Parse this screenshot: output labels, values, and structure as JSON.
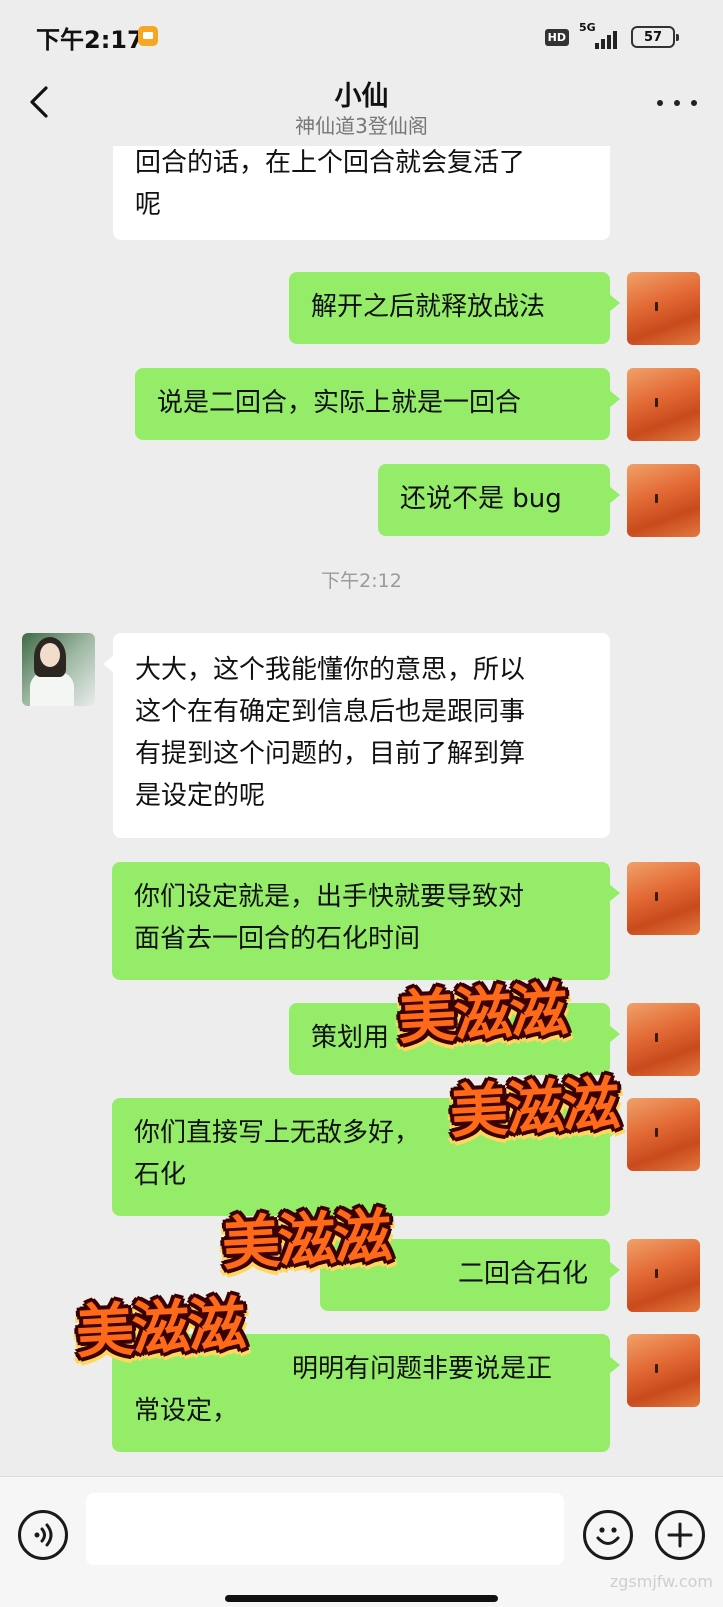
{
  "status_bar": {
    "time": "下午2:17",
    "network": "5G",
    "hd": "HD",
    "battery": "57"
  },
  "header": {
    "title": "小仙",
    "subtitle": "神仙道3登仙阁"
  },
  "messages": [
    {
      "side": "in",
      "lines": [
        "回合的话，在上个回合就会复活了",
        "呢"
      ]
    },
    {
      "side": "out",
      "lines": [
        "解开之后就释放战法"
      ]
    },
    {
      "side": "out",
      "lines": [
        "说是二回合，实际上就是一回合"
      ]
    },
    {
      "side": "out",
      "lines": [
        "还说不是 bug"
      ]
    },
    {
      "side": "timestamp",
      "text": "下午2:12"
    },
    {
      "side": "in",
      "lines": [
        "大大，这个我能懂你的意思，所以",
        "这个在有确定到信息后也是跟同事",
        "有提到这个问题的，目前了解到算",
        "是设定的呢"
      ]
    },
    {
      "side": "out",
      "lines": [
        "你们设定就是，出手快就要导致对",
        "面省去一回合的石化时间"
      ]
    },
    {
      "side": "out",
      "lines": [
        "策划用"
      ]
    },
    {
      "side": "out",
      "lines": [
        "你们直接写上无敌多好，",
        "石化"
      ]
    },
    {
      "side": "out",
      "lines": [
        "二回合石化"
      ]
    },
    {
      "side": "out",
      "lines": [
        "明明有问题非要说是正",
        "常设定，"
      ]
    }
  ],
  "sticker_text": "美滋滋",
  "input": {
    "value": "",
    "placeholder": ""
  },
  "watermark": "zgsmjfw.com"
}
